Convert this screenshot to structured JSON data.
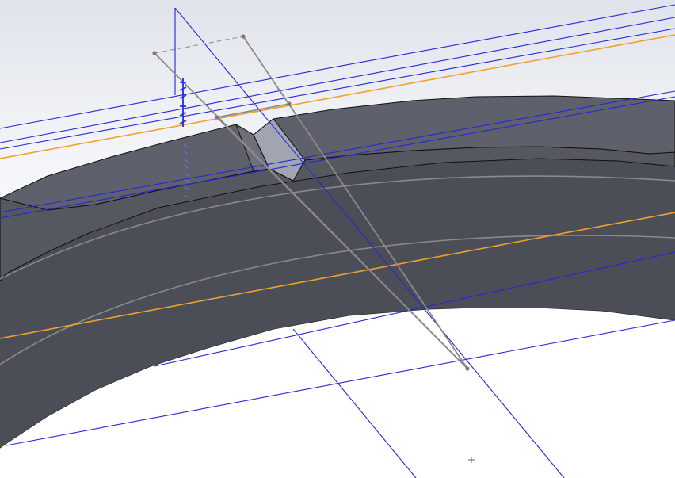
{
  "viewport": {
    "background": "#ffffff",
    "accent_colors": {
      "sketch_blue": "#2626d6",
      "centerline_orange": "#f0a22a",
      "body_face": "#5c5f69",
      "body_top_face": "#535660",
      "construction_gray": "#8c8c8c"
    },
    "cursor_icon": "crosshair-plus-icon",
    "dimension_icon": "vertical-dimension-icon"
  }
}
